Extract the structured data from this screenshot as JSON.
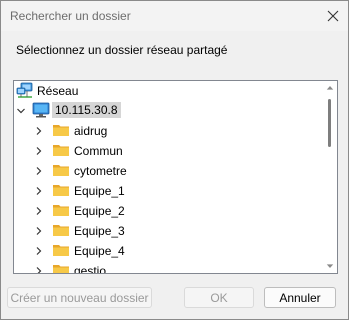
{
  "dialog": {
    "title": "Rechercher un dossier",
    "instruction": "Sélectionnez un dossier réseau partagé"
  },
  "tree": {
    "root": {
      "label": "Réseau",
      "icon": "network-icon"
    },
    "computer": {
      "label": "10.115.30.8",
      "icon": "computer-icon",
      "expanded": true,
      "selected": true
    },
    "folders": [
      {
        "label": "aidrug"
      },
      {
        "label": "Commun"
      },
      {
        "label": "cytometre"
      },
      {
        "label": "Equipe_1"
      },
      {
        "label": "Equipe_2"
      },
      {
        "label": "Equipe_3"
      },
      {
        "label": "Equipe_4"
      },
      {
        "label": "gestio"
      }
    ]
  },
  "buttons": {
    "new_folder": "Créer un nouveau dossier",
    "ok": "OK",
    "cancel": "Annuler"
  },
  "colors": {
    "folder": "#f5c542",
    "selection": "#d6d6d6",
    "accent": "#0067c0"
  }
}
